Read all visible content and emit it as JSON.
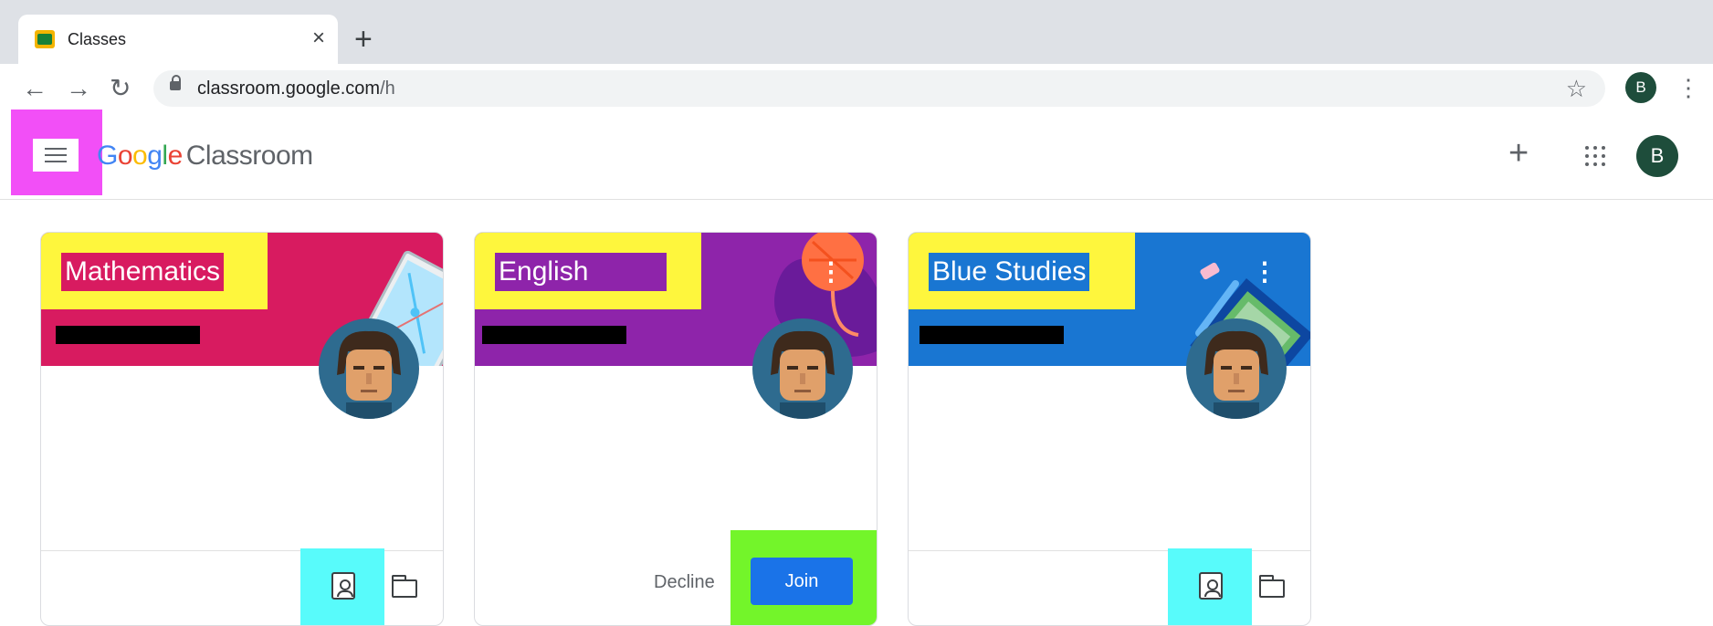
{
  "browser": {
    "tab_title": "Classes",
    "tab_close": "×",
    "new_tab": "+",
    "url_host": "classroom.google.com",
    "url_path": "/h",
    "profile_initial": "B",
    "back": "←",
    "forward": "→",
    "reload": "↻",
    "star": "☆",
    "menu": "⋮"
  },
  "header": {
    "logo_letters": [
      "G",
      "o",
      "o",
      "g",
      "l",
      "e"
    ],
    "logo_product": "Classroom",
    "create_icon": "+",
    "profile_initial": "B"
  },
  "classes": [
    {
      "name": "Mathematics",
      "color": "#d81b60",
      "footer": "icons",
      "icons": [
        "assignment-icon",
        "folder-icon"
      ]
    },
    {
      "name": "English",
      "color": "#8e24aa",
      "footer": "invitation",
      "menu": "⋮",
      "decline_label": "Decline",
      "join_label": "Join"
    },
    {
      "name": "Blue Studies",
      "color": "#1976d2",
      "footer": "icons",
      "menu": "⋮",
      "icons": [
        "assignment-icon",
        "folder-icon"
      ]
    }
  ],
  "highlight_colors": {
    "menu": "#f24ff7",
    "titles": "#fef63d",
    "icons": "#58fbfb",
    "join": "#73f52a"
  }
}
